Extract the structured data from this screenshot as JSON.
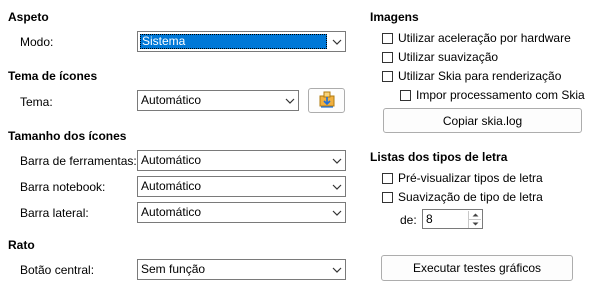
{
  "appearance": {
    "heading": "Aspeto",
    "mode_label": "Modo:",
    "mode_value": "Sistema"
  },
  "icon_theme": {
    "heading": "Tema de ícones",
    "theme_label": "Tema:",
    "theme_value": "Automático"
  },
  "icon_size": {
    "heading": "Tamanho dos ícones",
    "toolbar_label": "Barra de ferramentas:",
    "toolbar_value": "Automático",
    "notebookbar_label": "Barra notebook:",
    "notebookbar_value": "Automático",
    "sidebar_label": "Barra lateral:",
    "sidebar_value": "Automático"
  },
  "mouse": {
    "heading": "Rato",
    "middle_button_label": "Botão central:",
    "middle_button_value": "Sem função"
  },
  "images": {
    "heading": "Imagens",
    "hw_accel": {
      "label": "Utilizar aceleração por hardware",
      "checked": false
    },
    "antialias": {
      "label": "Utilizar suavização",
      "checked": false
    },
    "skia": {
      "label": "Utilizar Skia para renderização",
      "checked": false
    },
    "force_skia": {
      "label": "Impor processamento com Skia",
      "checked": false
    },
    "copy_skia_log_button": "Copiar skia.log"
  },
  "font_lists": {
    "heading": "Listas dos tipos de letra",
    "preview": {
      "label": "Pré-visualizar tipos de letra",
      "checked": false
    },
    "screen_antialias": {
      "label": "Suavização de tipo de letra",
      "checked": false
    },
    "from_label": "de:",
    "from_value": "8"
  },
  "run_graphics_tests_button": "Executar testes gráficos"
}
